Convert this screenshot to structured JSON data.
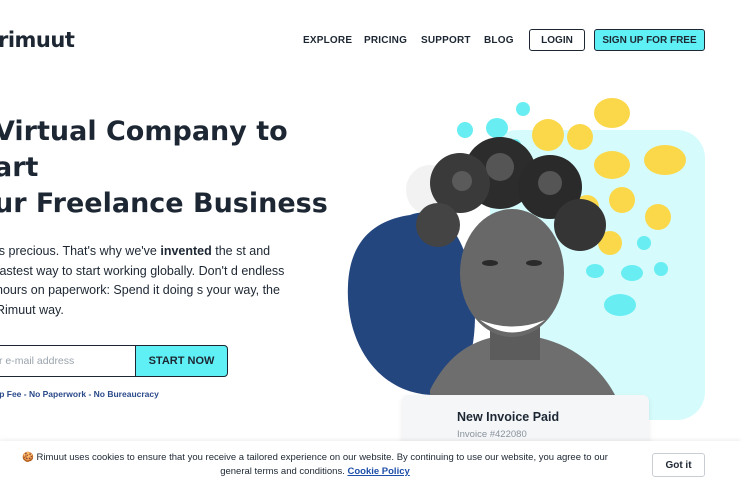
{
  "header": {
    "logo_text": "rimuut",
    "nav": [
      "EXPLORE",
      "PRICING",
      "SUPPORT",
      "BLOG"
    ],
    "login_label": "LOGIN",
    "signup_label": "SIGN UP FOR FREE"
  },
  "hero": {
    "headline_lines": [
      "Virtual Company to",
      "art",
      "ur Freelance Business"
    ],
    "intro_before": "is precious. That's why we've ",
    "intro_bold": "invented",
    "intro_after": " the st and fastest way to start working globally. Don't d endless hours on paperwork: Spend it doing s your way, the Rimuut way.",
    "email_placeholder": "r e-mail address",
    "start_label": "START NOW",
    "tagline": "up Fee - No Paperwork - No Bureaucracy"
  },
  "card": {
    "title": "New Invoice Paid",
    "subtitle": "Invoice #422080"
  },
  "cookie": {
    "icon": "cookie-icon",
    "text": "Rimuut uses cookies to ensure that you receive a tailored experience on our website. By continuing to use our website, you agree to our general terms and conditions.",
    "link": "Cookie Policy",
    "button": "Got it"
  },
  "colors": {
    "accent_cyan": "#5ef0f5",
    "navy": "#1d2733",
    "blob_blue": "#24467f",
    "light_cyan": "#d5fbfc",
    "yellow": "#fbd84a"
  }
}
